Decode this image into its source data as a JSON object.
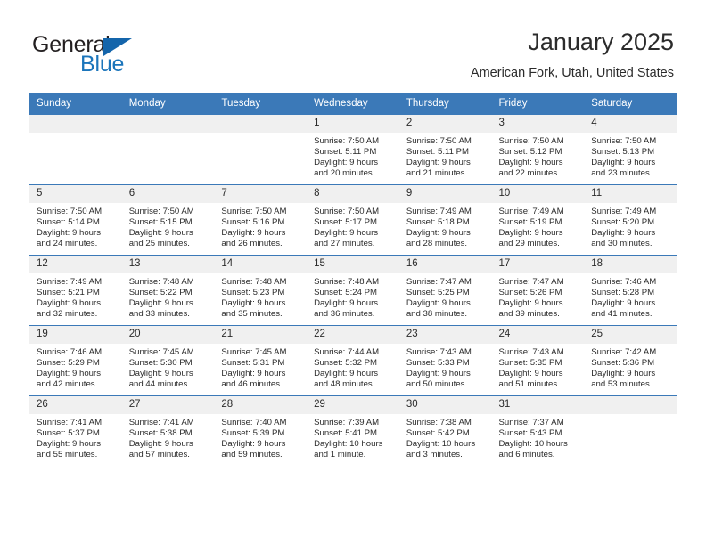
{
  "brand": {
    "name_top": "General",
    "name_bottom": "Blue",
    "triangle_color": "#1465ab",
    "blue_color": "#1b75bb"
  },
  "header": {
    "title": "January 2025",
    "location": "American Fork, Utah, United States"
  },
  "theme": {
    "header_row_bg": "#3b79b8",
    "daynum_bg": "#f0f0f0",
    "grid_line": "#3b79b8",
    "text": "#2b2b2b"
  },
  "weekday_headers": [
    "Sunday",
    "Monday",
    "Tuesday",
    "Wednesday",
    "Thursday",
    "Friday",
    "Saturday"
  ],
  "labels": {
    "sunrise_prefix": "Sunrise:",
    "sunset_prefix": "Sunset:",
    "daylight_prefix": "Daylight:"
  },
  "weeks": [
    [
      {
        "day": "",
        "sunrise": "",
        "sunset": "",
        "daylight": "",
        "blank": true
      },
      {
        "day": "",
        "sunrise": "",
        "sunset": "",
        "daylight": "",
        "blank": true
      },
      {
        "day": "",
        "sunrise": "",
        "sunset": "",
        "daylight": "",
        "blank": true
      },
      {
        "day": "1",
        "sunrise": "Sunrise: 7:50 AM",
        "sunset": "Sunset: 5:11 PM",
        "daylight": "Daylight: 9 hours and 20 minutes."
      },
      {
        "day": "2",
        "sunrise": "Sunrise: 7:50 AM",
        "sunset": "Sunset: 5:11 PM",
        "daylight": "Daylight: 9 hours and 21 minutes."
      },
      {
        "day": "3",
        "sunrise": "Sunrise: 7:50 AM",
        "sunset": "Sunset: 5:12 PM",
        "daylight": "Daylight: 9 hours and 22 minutes."
      },
      {
        "day": "4",
        "sunrise": "Sunrise: 7:50 AM",
        "sunset": "Sunset: 5:13 PM",
        "daylight": "Daylight: 9 hours and 23 minutes."
      }
    ],
    [
      {
        "day": "5",
        "sunrise": "Sunrise: 7:50 AM",
        "sunset": "Sunset: 5:14 PM",
        "daylight": "Daylight: 9 hours and 24 minutes."
      },
      {
        "day": "6",
        "sunrise": "Sunrise: 7:50 AM",
        "sunset": "Sunset: 5:15 PM",
        "daylight": "Daylight: 9 hours and 25 minutes."
      },
      {
        "day": "7",
        "sunrise": "Sunrise: 7:50 AM",
        "sunset": "Sunset: 5:16 PM",
        "daylight": "Daylight: 9 hours and 26 minutes."
      },
      {
        "day": "8",
        "sunrise": "Sunrise: 7:50 AM",
        "sunset": "Sunset: 5:17 PM",
        "daylight": "Daylight: 9 hours and 27 minutes."
      },
      {
        "day": "9",
        "sunrise": "Sunrise: 7:49 AM",
        "sunset": "Sunset: 5:18 PM",
        "daylight": "Daylight: 9 hours and 28 minutes."
      },
      {
        "day": "10",
        "sunrise": "Sunrise: 7:49 AM",
        "sunset": "Sunset: 5:19 PM",
        "daylight": "Daylight: 9 hours and 29 minutes."
      },
      {
        "day": "11",
        "sunrise": "Sunrise: 7:49 AM",
        "sunset": "Sunset: 5:20 PM",
        "daylight": "Daylight: 9 hours and 30 minutes."
      }
    ],
    [
      {
        "day": "12",
        "sunrise": "Sunrise: 7:49 AM",
        "sunset": "Sunset: 5:21 PM",
        "daylight": "Daylight: 9 hours and 32 minutes."
      },
      {
        "day": "13",
        "sunrise": "Sunrise: 7:48 AM",
        "sunset": "Sunset: 5:22 PM",
        "daylight": "Daylight: 9 hours and 33 minutes."
      },
      {
        "day": "14",
        "sunrise": "Sunrise: 7:48 AM",
        "sunset": "Sunset: 5:23 PM",
        "daylight": "Daylight: 9 hours and 35 minutes."
      },
      {
        "day": "15",
        "sunrise": "Sunrise: 7:48 AM",
        "sunset": "Sunset: 5:24 PM",
        "daylight": "Daylight: 9 hours and 36 minutes."
      },
      {
        "day": "16",
        "sunrise": "Sunrise: 7:47 AM",
        "sunset": "Sunset: 5:25 PM",
        "daylight": "Daylight: 9 hours and 38 minutes."
      },
      {
        "day": "17",
        "sunrise": "Sunrise: 7:47 AM",
        "sunset": "Sunset: 5:26 PM",
        "daylight": "Daylight: 9 hours and 39 minutes."
      },
      {
        "day": "18",
        "sunrise": "Sunrise: 7:46 AM",
        "sunset": "Sunset: 5:28 PM",
        "daylight": "Daylight: 9 hours and 41 minutes."
      }
    ],
    [
      {
        "day": "19",
        "sunrise": "Sunrise: 7:46 AM",
        "sunset": "Sunset: 5:29 PM",
        "daylight": "Daylight: 9 hours and 42 minutes."
      },
      {
        "day": "20",
        "sunrise": "Sunrise: 7:45 AM",
        "sunset": "Sunset: 5:30 PM",
        "daylight": "Daylight: 9 hours and 44 minutes."
      },
      {
        "day": "21",
        "sunrise": "Sunrise: 7:45 AM",
        "sunset": "Sunset: 5:31 PM",
        "daylight": "Daylight: 9 hours and 46 minutes."
      },
      {
        "day": "22",
        "sunrise": "Sunrise: 7:44 AM",
        "sunset": "Sunset: 5:32 PM",
        "daylight": "Daylight: 9 hours and 48 minutes."
      },
      {
        "day": "23",
        "sunrise": "Sunrise: 7:43 AM",
        "sunset": "Sunset: 5:33 PM",
        "daylight": "Daylight: 9 hours and 50 minutes."
      },
      {
        "day": "24",
        "sunrise": "Sunrise: 7:43 AM",
        "sunset": "Sunset: 5:35 PM",
        "daylight": "Daylight: 9 hours and 51 minutes."
      },
      {
        "day": "25",
        "sunrise": "Sunrise: 7:42 AM",
        "sunset": "Sunset: 5:36 PM",
        "daylight": "Daylight: 9 hours and 53 minutes."
      }
    ],
    [
      {
        "day": "26",
        "sunrise": "Sunrise: 7:41 AM",
        "sunset": "Sunset: 5:37 PM",
        "daylight": "Daylight: 9 hours and 55 minutes."
      },
      {
        "day": "27",
        "sunrise": "Sunrise: 7:41 AM",
        "sunset": "Sunset: 5:38 PM",
        "daylight": "Daylight: 9 hours and 57 minutes."
      },
      {
        "day": "28",
        "sunrise": "Sunrise: 7:40 AM",
        "sunset": "Sunset: 5:39 PM",
        "daylight": "Daylight: 9 hours and 59 minutes."
      },
      {
        "day": "29",
        "sunrise": "Sunrise: 7:39 AM",
        "sunset": "Sunset: 5:41 PM",
        "daylight": "Daylight: 10 hours and 1 minute."
      },
      {
        "day": "30",
        "sunrise": "Sunrise: 7:38 AM",
        "sunset": "Sunset: 5:42 PM",
        "daylight": "Daylight: 10 hours and 3 minutes."
      },
      {
        "day": "31",
        "sunrise": "Sunrise: 7:37 AM",
        "sunset": "Sunset: 5:43 PM",
        "daylight": "Daylight: 10 hours and 6 minutes."
      },
      {
        "day": "",
        "sunrise": "",
        "sunset": "",
        "daylight": "",
        "blank": true
      }
    ]
  ]
}
